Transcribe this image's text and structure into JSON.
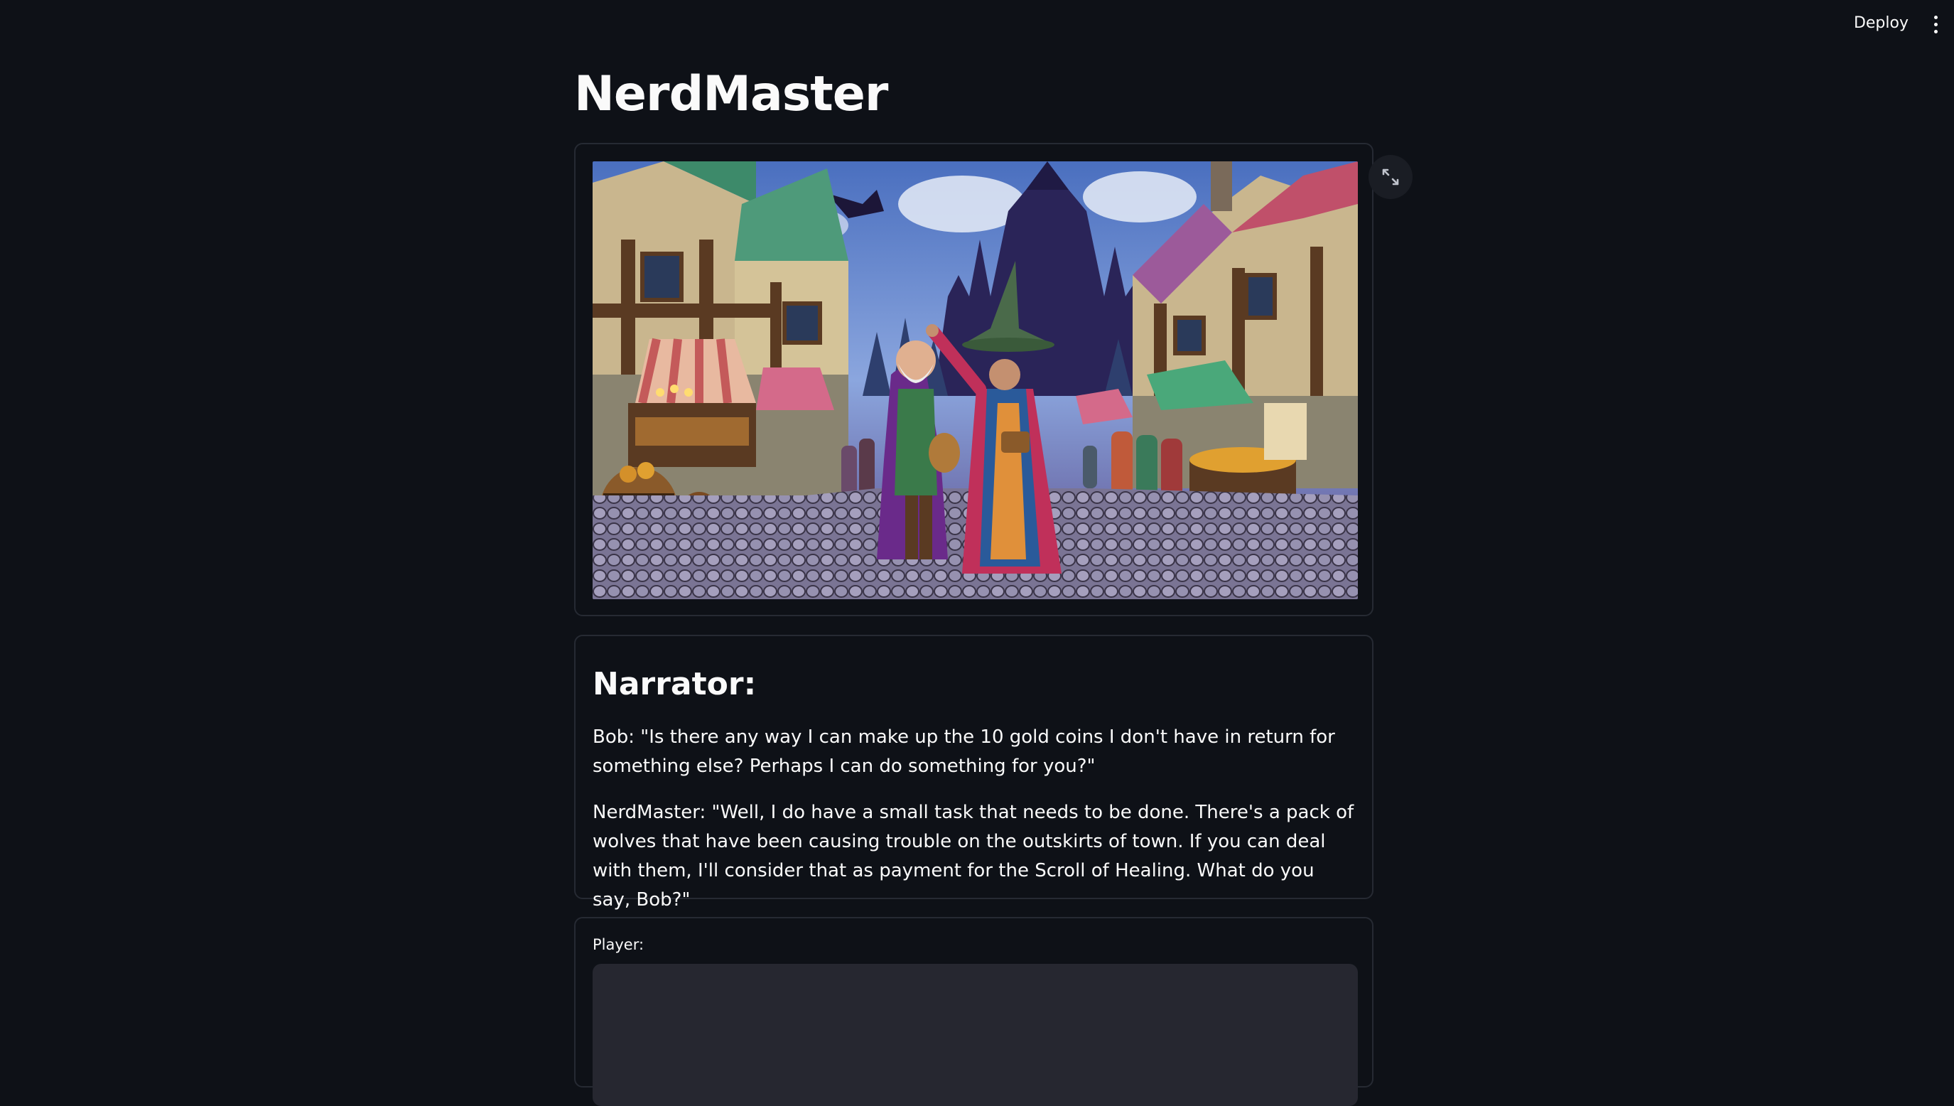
{
  "header": {
    "deploy_label": "Deploy",
    "menu_icon": "kebab-menu-icon"
  },
  "app": {
    "title": "NerdMaster"
  },
  "image": {
    "expand_icon": "expand-fullscreen-icon"
  },
  "narrator": {
    "heading": "Narrator:",
    "paragraphs": [
      "Bob: \"Is there any way I can make up the 10 gold coins I don't have in return for something else? Perhaps I can do something for you?\"",
      "NerdMaster: \"Well, I do have a small task that needs to be done. There's a pack of wolves that have been causing trouble on the outskirts of town. If you can deal with them, I'll consider that as payment for the Scroll of Healing. What do you say, Bob?\""
    ]
  },
  "player": {
    "label": "Player:",
    "value": "",
    "placeholder": ""
  },
  "colors": {
    "background": "#0e1117",
    "card_border": "#262a33",
    "input_bg": "#262730",
    "text": "#fafafa"
  }
}
